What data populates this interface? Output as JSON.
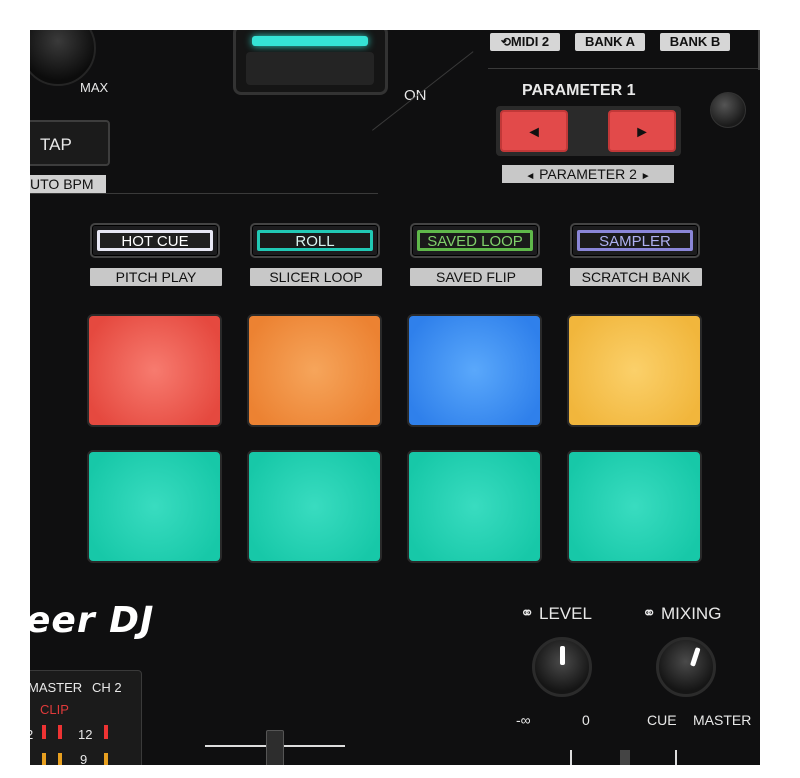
{
  "top": {
    "max_label": "MAX",
    "tap_label": "TAP",
    "auto_bpm_label": "UTO BPM",
    "on_label": "ON",
    "midi_label": "MIDI 2",
    "bank_a_label": "BANK A",
    "bank_b_label": "BANK B",
    "parameter1_label": "PARAMETER 1",
    "parameter2_label": "PARAMETER 2",
    "param_left_glyph": "◄",
    "param_right_glyph": "►",
    "param2_left_glyph": "◄",
    "param2_right_glyph": "►"
  },
  "modes": [
    {
      "label": "HOT CUE",
      "sub": "PITCH PLAY",
      "color": "#e6e6f5"
    },
    {
      "label": "ROLL",
      "sub": "SLICER LOOP",
      "color": "#21c9b5"
    },
    {
      "label": "SAVED LOOP",
      "sub": "SAVED FLIP",
      "color": "#5fb84a"
    },
    {
      "label": "SAMPLER",
      "sub": "SCRATCH BANK",
      "color": "#8a86d8"
    }
  ],
  "pads": [
    {
      "color": "#ef5b50"
    },
    {
      "color": "#f0923e"
    },
    {
      "color": "#3f8ff0"
    },
    {
      "color": "#f6bf4b"
    },
    {
      "color": "#1fd0b0"
    },
    {
      "color": "#1fd0b0"
    },
    {
      "color": "#1fd0b0"
    },
    {
      "color": "#1fd0b0"
    }
  ],
  "brand": "eer DJ",
  "bottom": {
    "level_label": "LEVEL",
    "mixing_label": "MIXING",
    "level_min": "-∞",
    "level_max": "0",
    "mix_cue": "CUE",
    "mix_master": "MASTER",
    "meter_master": "MASTER",
    "meter_ch2": "CH 2",
    "meter_clip": "CLIP",
    "meter_12": "12",
    "meter_2": "2",
    "meter_9": "9"
  }
}
